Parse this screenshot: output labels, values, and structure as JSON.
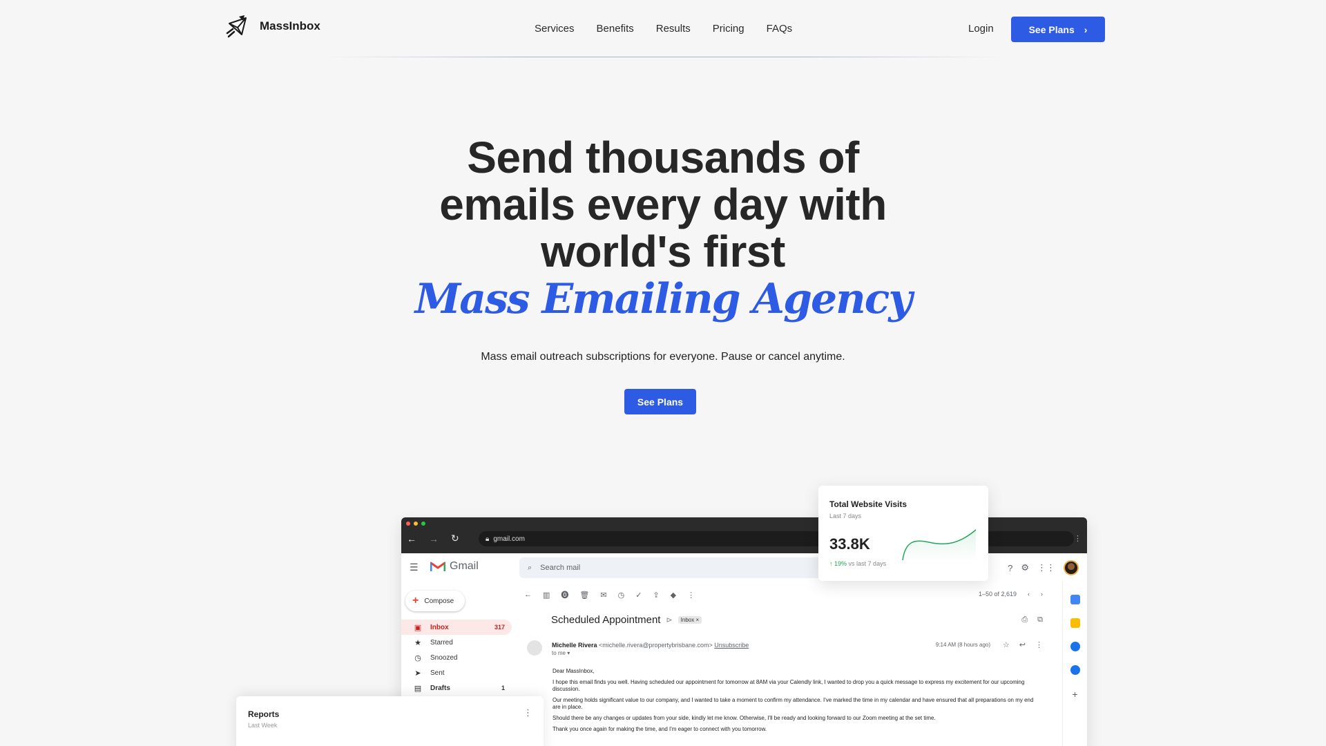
{
  "brand": {
    "name": "MassInbox"
  },
  "nav": {
    "links": [
      "Services",
      "Benefits",
      "Results",
      "Pricing",
      "FAQs"
    ],
    "login": "Login",
    "cta": "See Plans"
  },
  "hero": {
    "title_line1": "Send thousands of",
    "title_line2": "emails every day with",
    "title_line3": "world's first",
    "accent": "Mass Emailing Agency",
    "subtitle": "Mass email outreach subscriptions for everyone. Pause or cancel anytime.",
    "cta": "See Plans"
  },
  "colors": {
    "accent": "#2d5be3",
    "positive": "#22a55b"
  },
  "browser": {
    "url": "gmail.com",
    "gmail_label": "Gmail",
    "search_placeholder": "Search mail",
    "compose": "Compose",
    "sidebar": [
      {
        "icon": "inbox-icon",
        "label": "Inbox",
        "count": "317"
      },
      {
        "icon": "star-icon",
        "label": "Starred",
        "count": ""
      },
      {
        "icon": "clock-icon",
        "label": "Snoozed",
        "count": ""
      },
      {
        "icon": "send-icon",
        "label": "Sent",
        "count": ""
      },
      {
        "icon": "draft-icon",
        "label": "Drafts",
        "count": "1"
      }
    ],
    "pager": "1–50 of 2,619",
    "subject": "Scheduled Appointment",
    "subject_tag": "Inbox ×",
    "sender_name": "Michelle Rivera",
    "sender_email": "<michelle.rivera@propertybrisbane.com>",
    "unsubscribe": "Unsubscribe",
    "to": "to me ▾",
    "time": "9:14 AM (8 hours ago)",
    "body": [
      "Dear MassInbox,",
      "I hope this email finds you well. Having scheduled our appointment for tomorrow at 8AM via your Calendly link, I wanted to drop you a quick message to express my excitement for our upcoming discussion.",
      "Our meeting holds significant value to our company, and I wanted to take a moment to confirm my attendance. I've marked the time in my calendar and have ensured that all preparations on my end are in place.",
      "Should there be any changes or updates from your side, kindly let me know. Otherwise, I'll be ready and looking forward to our Zoom meeting at the set time.",
      "Thank you once again for making the time, and I'm eager to connect with you tomorrow."
    ]
  },
  "visits_card": {
    "title": "Total Website Visits",
    "period": "Last 7 days",
    "value": "33.8K",
    "delta": "19%",
    "delta_label": "vs last 7 days"
  },
  "reports_card": {
    "title": "Reports",
    "period": "Last Week"
  }
}
